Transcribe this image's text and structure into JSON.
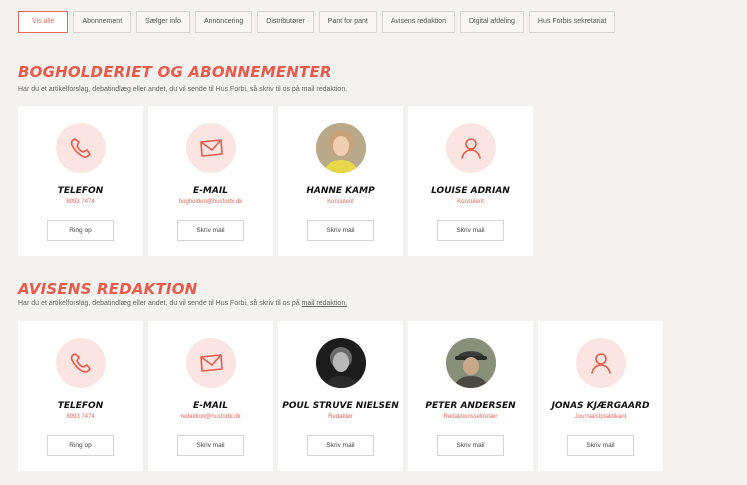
{
  "filters": [
    "Vis alle",
    "Abonnement",
    "Sælger info",
    "Annoncering",
    "Distributører",
    "Pant for pant",
    "Avisens redaktion",
    "Digital afdeling",
    "Hus Forbis sekretariat"
  ],
  "sections": [
    {
      "title": "Bogholderiet og abonnementer",
      "subtitle": "Har du et artikelforslag, debatindlæg eller andet, du vil sende til Hus Forbi, så skriv til os på mail redaktion.",
      "cards": [
        {
          "icon": "phone-icon",
          "name": "Telefon",
          "role": "8993 7474",
          "button": "Ring op"
        },
        {
          "icon": "mail-icon",
          "name": "E-mail",
          "role": "bogholderi@husforbi.dk",
          "button": "Skriv mail"
        },
        {
          "icon": "photo",
          "name": "Hanne Kamp",
          "role": "Konsulent",
          "button": "Skriv mail"
        },
        {
          "icon": "person-icon",
          "name": "Louise Adrian",
          "role": "Konsulent",
          "button": "Skriv mail"
        }
      ]
    },
    {
      "title": "Avisens redaktion",
      "subtitle_prefix": "Har du et artikelforslag, debatindlæg eller andet, du vil sende til Hus Forbi, så skriv til os på ",
      "subtitle_link": "mail redaktion.",
      "cards": [
        {
          "icon": "phone-icon",
          "name": "Telefon",
          "role": "8993 7474",
          "button": "Ring op"
        },
        {
          "icon": "mail-icon",
          "name": "E-mail",
          "role": "redaktion@husforbi.dk",
          "button": "Skriv mail"
        },
        {
          "icon": "photo",
          "name": "Poul Struve Nielsen",
          "role": "Redaktør",
          "button": "Skriv mail"
        },
        {
          "icon": "photo",
          "name": "Peter Andersen",
          "role": "Redaktionssekretær",
          "button": "Skriv mail"
        },
        {
          "icon": "person-icon",
          "name": "Jonas Kjærgaard",
          "role": "Journalistpraktikant",
          "button": "Skriv mail"
        }
      ]
    }
  ],
  "colors": {
    "accent": "#ea5a4a",
    "icon_bg": "#fbe5e2",
    "page_bg": "#f3f2f1"
  }
}
